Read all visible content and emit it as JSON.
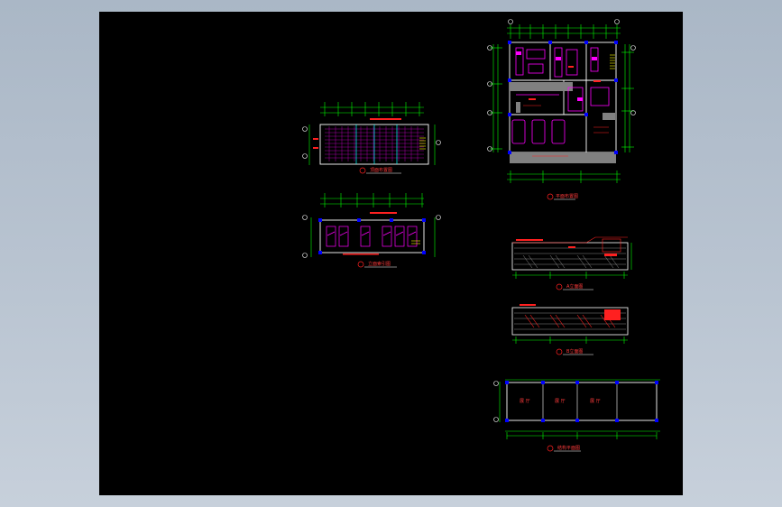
{
  "window": {
    "background_gradient": [
      "#aab7c6",
      "#c7d0db"
    ]
  },
  "canvas": {
    "background": "#000000",
    "line_colors": {
      "outline": "#ffffff",
      "dimension": "#00ff00",
      "furniture": "#ff00ff",
      "annotation": "#ff2020",
      "column": "#0000ff",
      "highlight": "#ffff00",
      "hatch": "#00ffff",
      "wall_fill": "#808080"
    }
  },
  "drawings": [
    {
      "id": "floor-plan-main",
      "kind": "floor plan",
      "title": "平面布置图"
    },
    {
      "id": "ceiling-plan",
      "kind": "ceiling plan",
      "title": "顶面布置图"
    },
    {
      "id": "furniture-plan",
      "kind": "furniture plan",
      "title": "立面索引图"
    },
    {
      "id": "elevation-a",
      "kind": "elevation",
      "title": "A立面图"
    },
    {
      "id": "elevation-b",
      "kind": "elevation",
      "title": "B立面图"
    },
    {
      "id": "structure-plan",
      "kind": "structure plan",
      "title": "结构平面图"
    }
  ],
  "room_labels": [
    "展 厅",
    "展 厅",
    "展 厅"
  ]
}
